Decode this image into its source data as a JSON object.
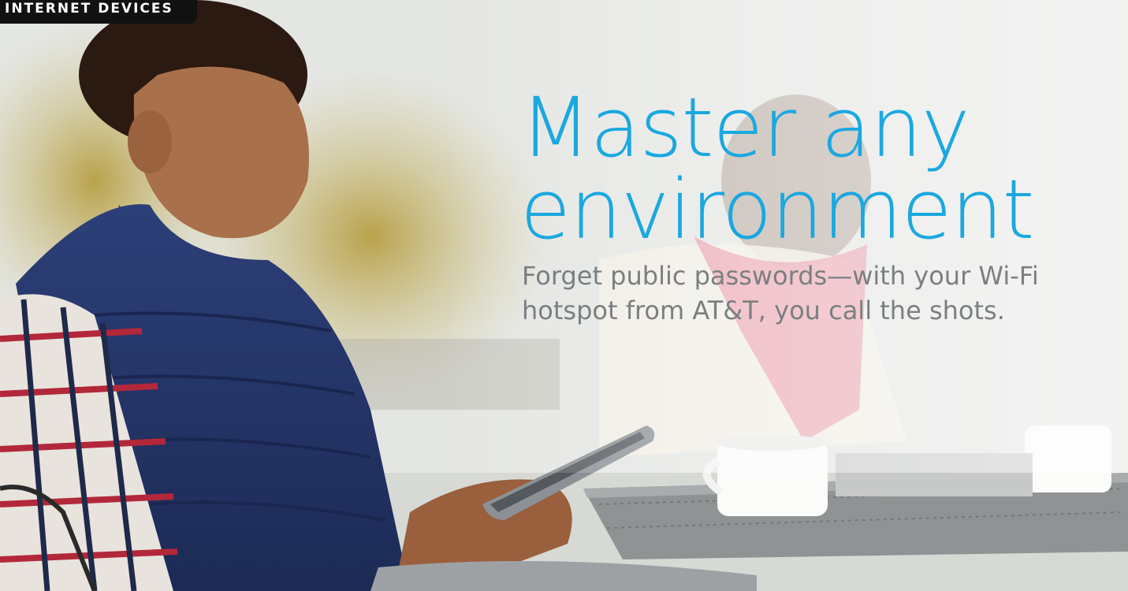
{
  "hero": {
    "tag_label": "INTERNET DEVICES",
    "headline_line1": "Master any",
    "headline_line2": "environment",
    "subhead": "Forget public passwords—with your Wi-Fi hotspot from AT&T, you call the shots."
  },
  "colors": {
    "headline": "#1aa8e0",
    "subhead": "#7b7f82",
    "tag_background": "#111111",
    "tag_text": "#ffffff"
  }
}
